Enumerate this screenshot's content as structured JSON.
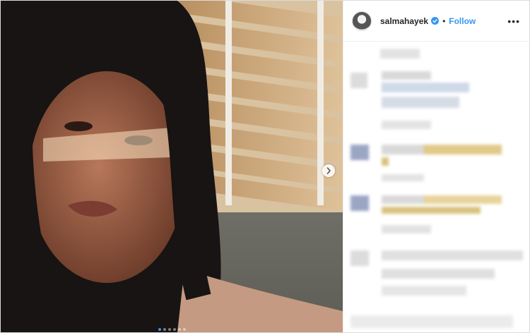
{
  "post": {
    "username": "salmahayek",
    "separator": "•",
    "follow_label": "Follow",
    "more_label": "•••",
    "carousel": {
      "total_slides": 6,
      "active_slide": 1
    }
  },
  "colors": {
    "accent": "#3897f0",
    "verified": "#3897f0",
    "username": "#262626"
  },
  "icons": {
    "verified": "verified-badge-icon",
    "more": "more-options-icon",
    "next": "chevron-right-icon"
  }
}
